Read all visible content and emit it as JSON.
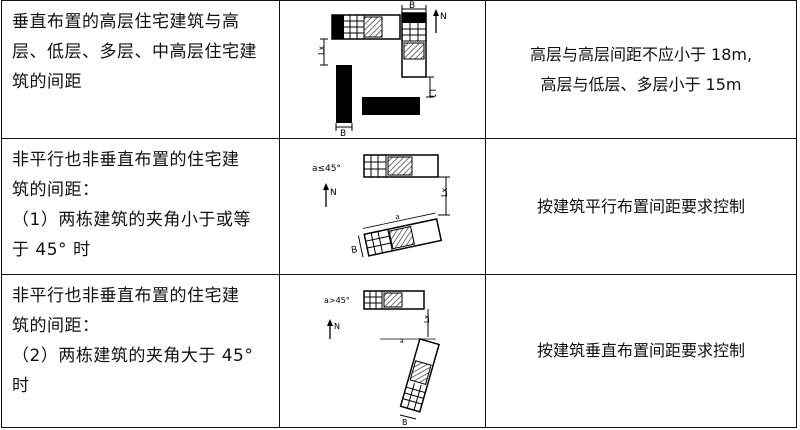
{
  "rows": [
    {
      "desc_lines": [
        "垂直布置的高层住宅建筑与高",
        "层、低层、多层、中高层住宅建",
        "筑的间距"
      ],
      "req_lines": [
        "高层与高层间距不应小于 18m,",
        "高层与低层、多层小于 15m"
      ],
      "diagram_labels": {
        "b_top": "B",
        "north": "N",
        "lx": "Lx",
        "ly": "L1",
        "b_bottom": "B"
      }
    },
    {
      "desc_lines": [
        "非平行也非垂直布置的住宅建",
        "筑的间距：",
        "（1）两栋建筑的夹角小于或等",
        "于 45° 时"
      ],
      "req_lines": [
        "按建筑平行布置间距要求控制"
      ],
      "diagram_labels": {
        "angle": "a≤45°",
        "north": "N",
        "lx": "Lx",
        "a": "a",
        "b": "B"
      }
    },
    {
      "desc_lines": [
        "非平行也非垂直布置的住宅建",
        "筑的间距：",
        "（2）两栋建筑的夹角大于 45°",
        "时"
      ],
      "req_lines": [
        "按建筑垂直布置间距要求控制"
      ],
      "diagram_labels": {
        "angle": "a>45°",
        "north": "N",
        "lx": "Lx",
        "a": "a",
        "b": "B"
      }
    }
  ]
}
